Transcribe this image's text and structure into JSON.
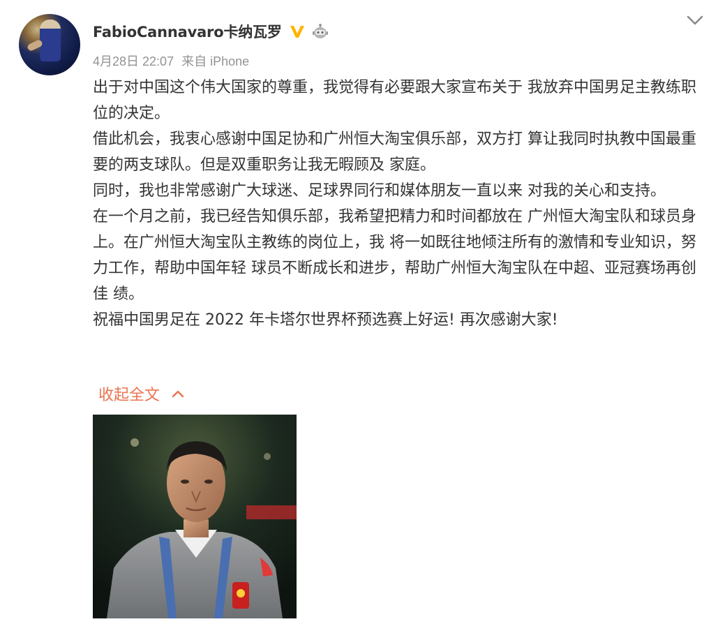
{
  "post": {
    "author": {
      "name": "FabioCannavaro卡纳瓦罗",
      "verified_icon": "verified-v-icon",
      "badge_icon": "robot-icon"
    },
    "meta": {
      "date": "4月28日 22:07",
      "source": "来自 iPhone"
    },
    "paragraphs": [
      "出于对中国这个伟大国家的尊重，我觉得有必要跟大家宣布关于 我放弃中国男足主教练职位的决定。",
      "借此机会，我衷心感谢中国足协和广州恒大淘宝俱乐部，双方打 算让我同时执教中国最重要的两支球队。但是双重职务让我无暇顾及 家庭。",
      "同时，我也非常感谢广大球迷、足球界同行和媒体朋友一直以来 对我的关心和支持。",
      "在一个月之前，我已经告知俱乐部，我希望把精力和时间都放在 广州恒大淘宝队和球员身上。在广州恒大淘宝队主教练的岗位上，我 将一如既往地倾注所有的激情和专业知识，努力工作，帮助中国年轻 球员不断成长和进步，帮助广州恒大淘宝队在中超、亚冠赛场再创佳 绩。",
      "祝福中国男足在 2022 年卡塔尔世界杯预选赛上好运! 再次感谢大家!"
    ],
    "collapse_label": "收起全文",
    "colors": {
      "text": "#333333",
      "meta": "#939393",
      "accent": "#eb7350",
      "verified": "#ffb400"
    }
  }
}
